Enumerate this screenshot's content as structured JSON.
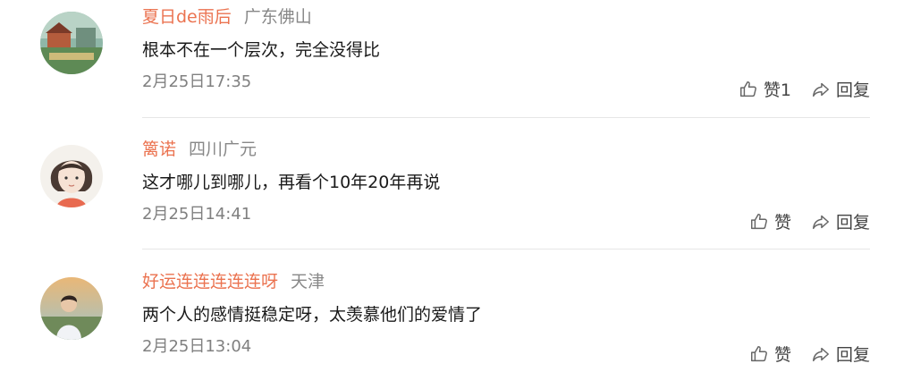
{
  "comments": [
    {
      "name": "夏日de雨后",
      "location": "广东佛山",
      "text": "根本不在一个层次，完全没得比",
      "time": "2月25日17:35",
      "like_label": "赞1",
      "reply_label": "回复"
    },
    {
      "name": "篱诺",
      "location": "四川广元",
      "text": "这才哪儿到哪儿，再看个10年20年再说",
      "time": "2月25日14:41",
      "like_label": "赞",
      "reply_label": "回复"
    },
    {
      "name": "好运连连连连连呀",
      "location": "天津",
      "text": "两个人的感情挺稳定呀，太羡慕他们的爱情了",
      "time": "2月25日13:04",
      "like_label": "赞",
      "reply_label": "回复"
    }
  ],
  "icons": {
    "like": "thumbs-up-icon",
    "reply": "share-arrow-icon"
  },
  "colors": {
    "username": "#eb7350",
    "location": "#888888",
    "time": "#808080",
    "divider": "#e6e6e6"
  }
}
